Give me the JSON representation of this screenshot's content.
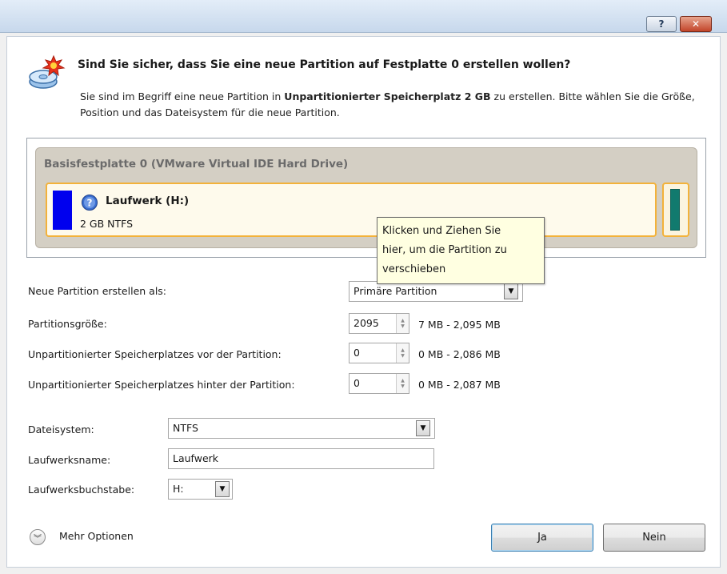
{
  "title_bar": {
    "help_label": "?",
    "close_label": "✕"
  },
  "header": {
    "heading": "Sind Sie sicher, dass Sie eine neue Partition auf Festplatte 0 erstellen wollen?",
    "desc_before": "Sie sind im Begriff eine neue Partition in ",
    "desc_bold": "Unpartitionierter Speicherplatz 2 GB",
    "desc_after": " zu erstellen. Bitte wählen Sie die Größe, Position und das Dateisystem für die neue Partition."
  },
  "disk": {
    "title": "Basisfestplatte 0 (VMware Virtual IDE Hard Drive)",
    "partition_name": "Laufwerk (H:)",
    "partition_info": "2 GB NTFS",
    "partition_color": "#0000ee",
    "unallocated_color": "#117a6e"
  },
  "tooltip": {
    "line1": "Klicken und Ziehen Sie",
    "line2": "hier, um die Partition zu",
    "line3": "verschieben"
  },
  "form": {
    "create_as_label": "Neue Partition erstellen als:",
    "create_as_value": "Primäre Partition",
    "size_label": "Partitionsgröße:",
    "size_value": "2095",
    "size_range": "7 MB - 2,095 MB",
    "before_label": "Unpartitionierter Speicherplatzes vor der Partition:",
    "before_value": "0",
    "before_range": "0 MB - 2,086 MB",
    "after_label": "Unpartitionierter Speicherplatzes hinter der Partition:",
    "after_value": "0",
    "after_range": "0 MB - 2,087 MB",
    "fs_label": "Dateisystem:",
    "fs_value": "NTFS",
    "name_label": "Laufwerksname:",
    "name_value": "Laufwerk",
    "letter_label": "Laufwerksbuchstabe:",
    "letter_value": "H:"
  },
  "footer": {
    "more_options": "Mehr Optionen",
    "yes": "Ja",
    "no": "Nein"
  }
}
